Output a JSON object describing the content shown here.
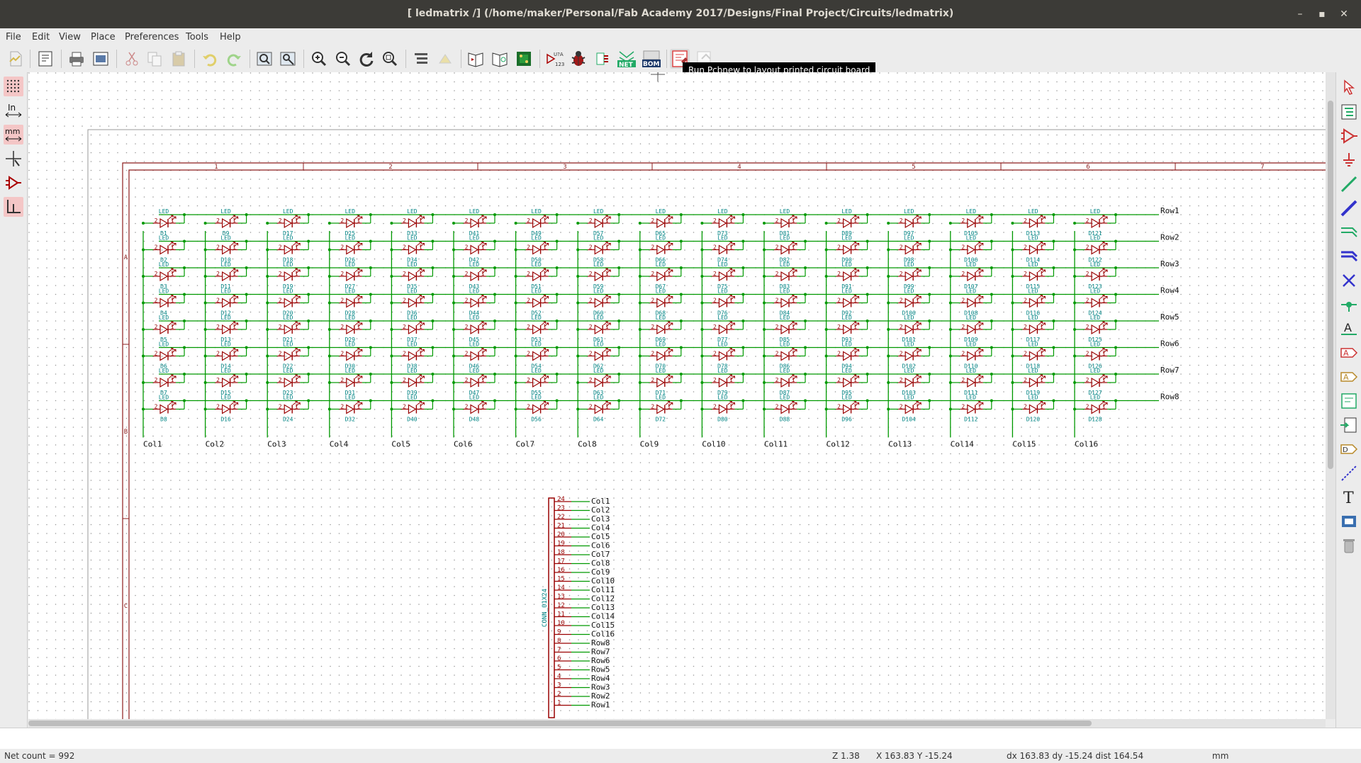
{
  "window": {
    "title": "[ ledmatrix /] (/home/maker/Personal/Fab Academy 2017/Designs/Final Project/Circuits/ledmatrix)",
    "controls": {
      "minimize": "–",
      "maximize": "▪",
      "close": "✕"
    }
  },
  "menu": [
    "File",
    "Edit",
    "View",
    "Place",
    "Preferences",
    "Tools",
    "Help"
  ],
  "toolbar": {
    "tooltip": "Run Pcbnew to layout printed circuit board",
    "annotate_label": "U?A",
    "annotate_sublabel": "123",
    "netlist_label": "NET",
    "bom_label": "BOM",
    "icons": [
      "new-icon",
      "page-settings-icon",
      "print-icon",
      "plot-icon",
      "cut-icon",
      "copy-icon",
      "paste-icon",
      "undo-icon",
      "redo-icon",
      "find-icon",
      "find-replace-icon",
      "zoom-in-icon",
      "zoom-out-icon",
      "redraw-icon",
      "zoom-fit-icon",
      "hierarchy-icon",
      "leave-sheet-icon",
      "library-editor-icon",
      "library-browser-icon",
      "cvpcb-icon",
      "annotate-icon",
      "erc-icon",
      "footprint-assign-icon",
      "netlist-icon",
      "bom-icon",
      "pcbnew-icon",
      "back-annotate-icon"
    ]
  },
  "left_toolbar": {
    "inch_label": "In",
    "mm_label": "mm",
    "icons": [
      "grid-toggle-icon",
      "units-inch-icon",
      "units-mm-icon",
      "cursor-shape-icon",
      "hidden-pins-icon",
      "wire-orientation-icon"
    ]
  },
  "right_toolbar": {
    "icons": [
      "select-arrow-icon",
      "hierarchy-navigator-icon",
      "place-component-icon",
      "place-power-icon",
      "place-wire-icon",
      "place-bus-icon",
      "wire-to-bus-entry-icon",
      "bus-to-bus-entry-icon",
      "no-connect-icon",
      "place-junction-icon",
      "place-net-label-icon",
      "place-global-label-icon",
      "place-hier-label-icon",
      "hier-sheet-icon",
      "import-hier-label-icon",
      "hier-pin-icon",
      "graphic-line-icon",
      "graphic-text-icon",
      "add-image-icon",
      "delete-icon"
    ]
  },
  "schematic": {
    "frame_columns": [
      "1",
      "2",
      "3",
      "4",
      "5",
      "6",
      "7"
    ],
    "frame_rows": [
      "A",
      "B",
      "C"
    ],
    "led_value": "LED",
    "pin_one": "1",
    "pin_two": "2",
    "row_labels": [
      "Row1",
      "Row2",
      "Row3",
      "Row4",
      "Row5",
      "Row6",
      "Row7",
      "Row8"
    ],
    "col_labels": [
      "Col1",
      "Col2",
      "Col3",
      "Col4",
      "Col5",
      "Col6",
      "Col7",
      "Col8",
      "Col9",
      "Col10",
      "Col11",
      "Col12",
      "Col13",
      "Col14",
      "Col15",
      "Col16"
    ],
    "connector": {
      "name": "CONN_01X24",
      "pins": [
        {
          "num": "24",
          "net": "Col1"
        },
        {
          "num": "23",
          "net": "Col2"
        },
        {
          "num": "22",
          "net": "Col3"
        },
        {
          "num": "21",
          "net": "Col4"
        },
        {
          "num": "20",
          "net": "Col5"
        },
        {
          "num": "19",
          "net": "Col6"
        },
        {
          "num": "18",
          "net": "Col7"
        },
        {
          "num": "17",
          "net": "Col8"
        },
        {
          "num": "16",
          "net": "Col9"
        },
        {
          "num": "15",
          "net": "Col10"
        },
        {
          "num": "14",
          "net": "Col11"
        },
        {
          "num": "13",
          "net": "Col12"
        },
        {
          "num": "12",
          "net": "Col13"
        },
        {
          "num": "11",
          "net": "Col14"
        },
        {
          "num": "10",
          "net": "Col15"
        },
        {
          "num": "9",
          "net": "Col16"
        },
        {
          "num": "8",
          "net": "Row8"
        },
        {
          "num": "7",
          "net": "Row7"
        },
        {
          "num": "6",
          "net": "Row6"
        },
        {
          "num": "5",
          "net": "Row5"
        },
        {
          "num": "4",
          "net": "Row4"
        },
        {
          "num": "3",
          "net": "Row3"
        },
        {
          "num": "2",
          "net": "Row2"
        },
        {
          "num": "1",
          "net": "Row1"
        }
      ]
    }
  },
  "status": {
    "net_count": "Net count = 992",
    "zoom": "Z 1.38",
    "coords": "X 163.83  Y -15.24",
    "delta": "dx 163.83  dy -15.24  dist 164.54",
    "units": "mm"
  },
  "colors": {
    "titlebar": "#3c3b37",
    "wire": "#009900",
    "component": "#990000",
    "field_text": "#008484",
    "frame": "#8c1c1c",
    "accent_red": "#cc3333"
  }
}
